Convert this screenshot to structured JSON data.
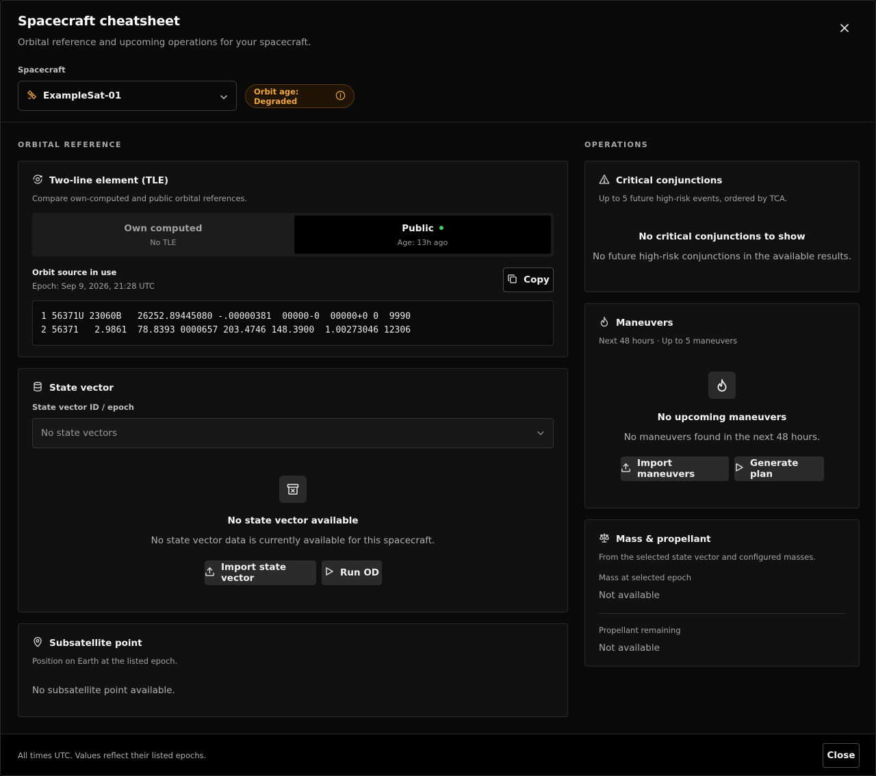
{
  "header": {
    "title": "Spacecraft cheatsheet",
    "subtitle": "Orbital reference and upcoming operations for your spacecraft.",
    "spacecraft_label": "Spacecraft",
    "spacecraft_value": "ExampleSat-01",
    "orbit_badge": "Orbit age: Degraded"
  },
  "sections": {
    "orbital": "ORBITAL REFERENCE",
    "operations": "OPERATIONS"
  },
  "tle": {
    "title": "Two-line element (TLE)",
    "desc": "Compare own-computed and public orbital references.",
    "own_label": "Own computed",
    "own_sub": "No TLE",
    "public_label": "Public",
    "public_sub": "Age: 13h ago",
    "source_label": "Orbit source in use",
    "epoch": "Epoch: Sep 9, 2026, 21:28 UTC",
    "copy_label": "Copy",
    "line1": "1 56371U 23060B   26252.89445080 -.00000381  00000-0  00000+0 0  9990",
    "line2": "2 56371   2.9861  78.8393 0000657 203.4746 148.3900  1.00273046 12306"
  },
  "state_vector": {
    "title": "State vector",
    "field_label": "State vector ID / epoch",
    "select_placeholder": "No state vectors",
    "empty_title": "No state vector available",
    "empty_desc": "No state vector data is currently available for this spacecraft.",
    "import_label": "Import state vector",
    "run_label": "Run OD"
  },
  "subsatellite": {
    "title": "Subsatellite point",
    "desc": "Position on Earth at the listed epoch.",
    "empty": "No subsatellite point available."
  },
  "conjunctions": {
    "title": "Critical conjunctions",
    "desc": "Up to 5 future high-risk events, ordered by TCA.",
    "empty_title": "No critical conjunctions to show",
    "empty_desc": "No future high-risk conjunctions in the available results."
  },
  "maneuvers": {
    "title": "Maneuvers",
    "desc": "Next 48 hours · Up to 5 maneuvers",
    "empty_title": "No upcoming maneuvers",
    "empty_desc": "No maneuvers found in the next 48 hours.",
    "import_label": "Import maneuvers",
    "generate_label": "Generate plan"
  },
  "mass": {
    "title": "Mass & propellant",
    "desc": "From the selected state vector and configured masses.",
    "mass_label": "Mass at selected epoch",
    "mass_value": "Not available",
    "prop_label": "Propellant remaining",
    "prop_value": "Not available"
  },
  "footer": {
    "note": "All times UTC. Values reflect their listed epochs.",
    "close_label": "Close"
  },
  "colors": {
    "accent_orange": "#f0a640",
    "status_green": "#3ecf6a"
  }
}
